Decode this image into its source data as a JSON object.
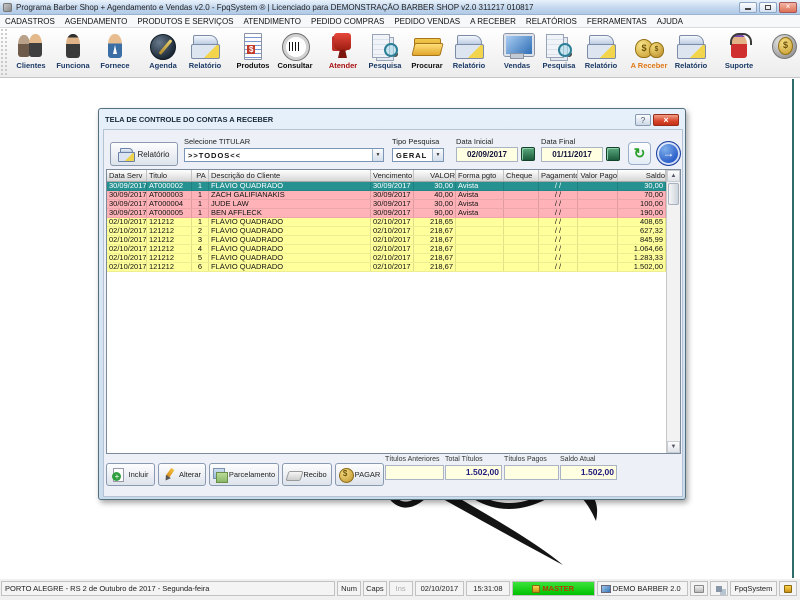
{
  "window": {
    "title": "Programa Barber Shop + Agendamento e Vendas v2.0 - FpqSystem ® | Licenciado para  DEMONSTRAÇÃO BARBER SHOP v2.0 311217 010817"
  },
  "menu": [
    "CADASTROS",
    "AGENDAMENTO",
    "PRODUTOS E SERVIÇOS",
    "ATENDIMENTO",
    "PEDIDO COMPRAS",
    "PEDIDO VENDAS",
    "A RECEBER",
    "RELATÓRIOS",
    "FERRAMENTAS",
    "AJUDA"
  ],
  "toolbar": [
    {
      "buttons": [
        {
          "name": "clients",
          "label": "Clientes",
          "icon": "clients-icon"
        },
        {
          "name": "employees",
          "label": "Funciona",
          "icon": "employee-icon"
        },
        {
          "name": "suppliers",
          "label": "Fornece",
          "icon": "supplier-icon"
        }
      ]
    },
    {
      "buttons": [
        {
          "name": "agenda",
          "label": "Agenda",
          "icon": "agenda-icon"
        },
        {
          "name": "agenda-report",
          "label": "Relatório",
          "icon": "report-icon"
        }
      ]
    },
    {
      "buttons": [
        {
          "name": "products",
          "label": "Produtos",
          "icon": "products-icon",
          "color": "#101010"
        },
        {
          "name": "consult",
          "label": "Consultar",
          "icon": "barcode-icon",
          "color": "#101010"
        }
      ]
    },
    {
      "buttons": [
        {
          "name": "attend",
          "label": "Atender",
          "icon": "chair-icon",
          "color": "#a81010"
        },
        {
          "name": "attend-search",
          "label": "Pesquisa",
          "icon": "search-icon"
        },
        {
          "name": "attend-find",
          "label": "Procurar",
          "icon": "folder-icon",
          "color": "#101010"
        },
        {
          "name": "attend-report",
          "label": "Relatório",
          "icon": "report-icon"
        }
      ]
    },
    {
      "buttons": [
        {
          "name": "sales",
          "label": "Vendas",
          "icon": "monitor-icon"
        },
        {
          "name": "sales-search",
          "label": "Pesquisa",
          "icon": "search-icon"
        },
        {
          "name": "sales-report",
          "label": "Relatório",
          "icon": "report-icon"
        }
      ]
    },
    {
      "buttons": [
        {
          "name": "receivables",
          "label": "A Receber",
          "icon": "money-icon",
          "color": "#e07818"
        },
        {
          "name": "receivables-report",
          "label": "Relatório",
          "icon": "report-icon"
        }
      ]
    },
    {
      "buttons": [
        {
          "name": "support",
          "label": "Suporte",
          "icon": "support-icon"
        }
      ]
    },
    {
      "buttons": [
        {
          "name": "cash",
          "label": "",
          "icon": "coin-icon"
        }
      ]
    },
    {
      "buttons": [
        {
          "name": "exit",
          "label": "",
          "icon": "exit-icon"
        }
      ]
    }
  ],
  "dialog": {
    "title": "TELA DE CONTROLE DO CONTAS A RECEBER",
    "help_button": "?",
    "close_button": "x",
    "report_button": "Relatório",
    "filters": {
      "titular_label": "Selecione TITULAR",
      "titular_value": ">>TODOS<<",
      "tipo_label": "Tipo  Pesquisa",
      "tipo_value": "GERAL",
      "start_label": "Data Inicial",
      "start_value": "02/09/2017",
      "end_label": "Data Final",
      "end_value": "01/11/2017"
    },
    "table": {
      "columns": [
        "Data Serv",
        "Titulo",
        "PA",
        "Descrição do Cliente",
        "Vencimento",
        "VALOR",
        "Forma pgto",
        "Cheque",
        "Pagamento",
        "Valor Pago",
        "Saldo"
      ],
      "rows": [
        {
          "state": "selected",
          "cells": [
            "30/09/2017",
            "AT000002",
            "1",
            "FLÁVIO QUADRADO",
            "30/09/2017",
            "30,00",
            "Avista",
            "",
            "/ /",
            "",
            "30,00"
          ]
        },
        {
          "state": "overdue",
          "cells": [
            "30/09/2017",
            "AT000003",
            "1",
            "ZACH GALIFIANAKIS",
            "30/09/2017",
            "40,00",
            "Avista",
            "",
            "/ /",
            "",
            "70,00"
          ]
        },
        {
          "state": "overdue",
          "cells": [
            "30/09/2017",
            "AT000004",
            "1",
            "JUDE LAW",
            "30/09/2017",
            "30,00",
            "Avista",
            "",
            "/ /",
            "",
            "100,00"
          ]
        },
        {
          "state": "overdue",
          "cells": [
            "30/09/2017",
            "AT000005",
            "1",
            "BEN AFFLECK",
            "30/09/2017",
            "90,00",
            "Avista",
            "",
            "/ /",
            "",
            "190,00"
          ]
        },
        {
          "state": "open",
          "cells": [
            "02/10/2017",
            "121212",
            "1",
            "FLÁVIO QUADRADO",
            "02/10/2017",
            "218,65",
            "",
            "",
            "/ /",
            "",
            "408,65"
          ]
        },
        {
          "state": "open",
          "cells": [
            "02/10/2017",
            "121212",
            "2",
            "FLÁVIO QUADRADO",
            "02/10/2017",
            "218,67",
            "",
            "",
            "/ /",
            "",
            "627,32"
          ]
        },
        {
          "state": "open",
          "cells": [
            "02/10/2017",
            "121212",
            "3",
            "FLÁVIO QUADRADO",
            "02/10/2017",
            "218,67",
            "",
            "",
            "/ /",
            "",
            "845,99"
          ]
        },
        {
          "state": "open",
          "cells": [
            "02/10/2017",
            "121212",
            "4",
            "FLÁVIO QUADRADO",
            "02/10/2017",
            "218,67",
            "",
            "",
            "/ /",
            "",
            "1.064,66"
          ]
        },
        {
          "state": "open",
          "cells": [
            "02/10/2017",
            "121212",
            "5",
            "FLÁVIO QUADRADO",
            "02/10/2017",
            "218,67",
            "",
            "",
            "/ /",
            "",
            "1.283,33"
          ]
        },
        {
          "state": "open",
          "cells": [
            "02/10/2017",
            "121212",
            "6",
            "FLÁVIO QUADRADO",
            "02/10/2017",
            "218,67",
            "",
            "",
            "/ /",
            "",
            "1.502,00"
          ]
        }
      ]
    },
    "actions": [
      {
        "name": "include",
        "label": "Incluir",
        "icon": "add-icon"
      },
      {
        "name": "edit",
        "label": "Alterar",
        "icon": "edit-icon"
      },
      {
        "name": "installments",
        "label": "Parcelamento",
        "icon": "installments-icon"
      },
      {
        "name": "receipt",
        "label": "Recibo",
        "icon": "receipt-icon"
      },
      {
        "name": "pay",
        "label": "PAGAR",
        "icon": "pay-icon"
      }
    ],
    "totals": [
      {
        "name": "previous-titles",
        "label": "Títulos Anteriores",
        "value": ""
      },
      {
        "name": "total-titles",
        "label": "Total Títulos",
        "value": "1.502,00"
      },
      {
        "name": "paid-titles",
        "label": "Títulos Pagos",
        "value": ""
      },
      {
        "name": "current-balance",
        "label": "Saldo Atual",
        "value": "1.502,00"
      }
    ]
  },
  "statusbar": {
    "location": "PORTO ALEGRE - RS  2 de Outubro de 2017 - Segunda-feira",
    "num_lock": "Num",
    "caps_lock": "Caps",
    "insert": "Ins",
    "date": "02/10/2017",
    "time": "15:31:08",
    "user": "MASTER",
    "database": "DEMO BARBER 2.0",
    "brand": "FpqSystem"
  },
  "colors": {
    "selected_row": "#259191",
    "overdue_row": "#ffb3b8",
    "open_row": "#ffff9c",
    "field_bg": "#ffffe1",
    "total_text": "#201a7e",
    "master_bg": "#00c000"
  }
}
